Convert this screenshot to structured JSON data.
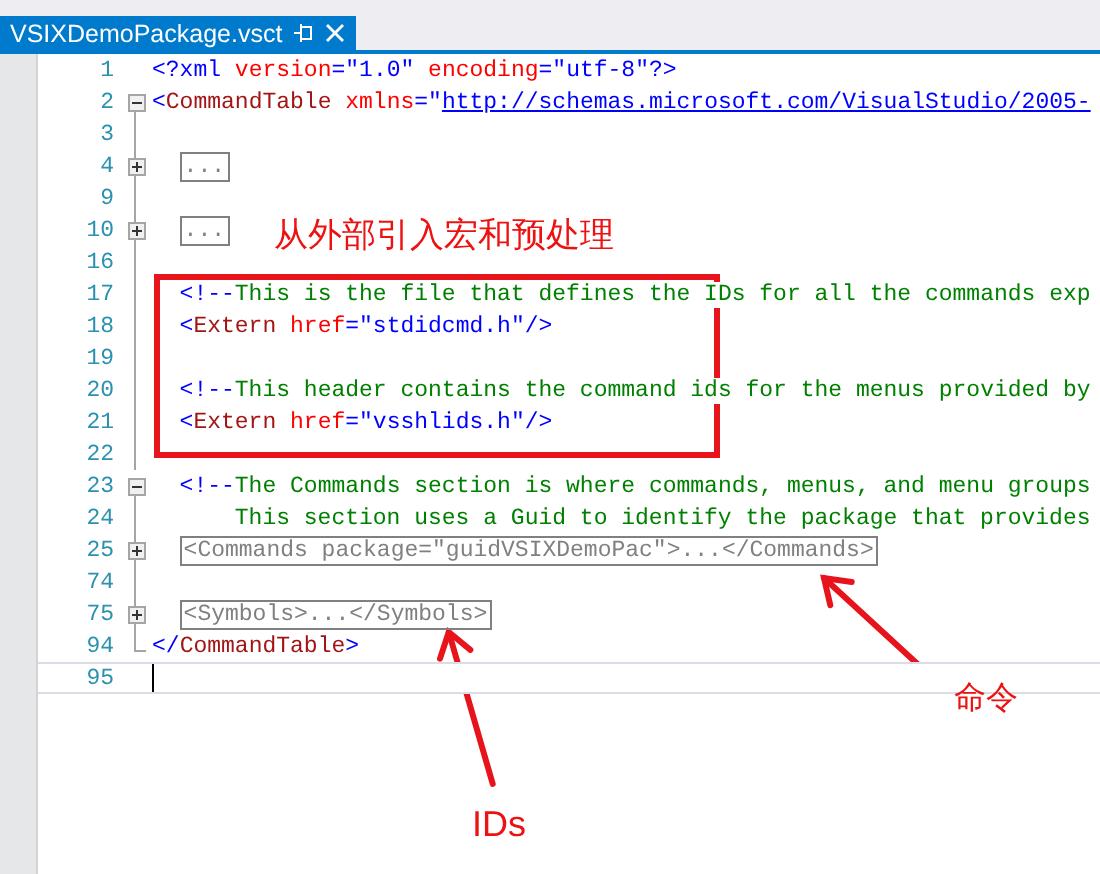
{
  "tab": {
    "title": "VSIXDemoPackage.vsct",
    "selected": true
  },
  "lines": [
    {
      "number": "1",
      "current": false,
      "tokens": [
        {
          "kind": "delim",
          "text": "<?xml "
        },
        {
          "kind": "attr",
          "text": "version"
        },
        {
          "kind": "delim",
          "text": "=\"1.0\" "
        },
        {
          "kind": "attr",
          "text": "encoding"
        },
        {
          "kind": "delim",
          "text": "=\"utf-8\"?>"
        }
      ]
    },
    {
      "number": "2",
      "current": false,
      "expanded": true,
      "tokens": [
        {
          "kind": "delim",
          "text": "<"
        },
        {
          "kind": "tag",
          "text": "CommandTable "
        },
        {
          "kind": "attr",
          "text": "xmlns"
        },
        {
          "kind": "delim",
          "text": "=\""
        },
        {
          "kind": "link",
          "text": "http://schemas.microsoft.com/VisualStudio/2005-"
        }
      ],
      "children": [
        {
          "number": "3",
          "current": false
        },
        {
          "number": "4",
          "current": false,
          "expanded": false,
          "tokens": [
            {
              "kind": "collapsed",
              "text": "..."
            }
          ]
        },
        {
          "number": "9",
          "current": false
        },
        {
          "number": "10",
          "current": false,
          "expanded": false,
          "tokens": [
            {
              "kind": "collapsed",
              "text": "..."
            }
          ]
        },
        {
          "number": "16",
          "current": false
        },
        {
          "number": "17",
          "current": false,
          "tokens": [
            {
              "kind": "delim",
              "text": "<!--"
            },
            {
              "kind": "comment",
              "text": "This is the file that defines the IDs for all the commands exp"
            }
          ]
        },
        {
          "number": "18",
          "current": false,
          "tokens": [
            {
              "kind": "delim",
              "text": "<"
            },
            {
              "kind": "tag",
              "text": "Extern "
            },
            {
              "kind": "attr",
              "text": "href"
            },
            {
              "kind": "delim",
              "text": "=\"stdidcmd.h\"/>"
            }
          ]
        },
        {
          "number": "19",
          "current": false
        },
        {
          "number": "20",
          "current": false,
          "tokens": [
            {
              "kind": "delim",
              "text": "<!--"
            },
            {
              "kind": "comment",
              "text": "This header contains the command ids for the menus provided by"
            }
          ]
        },
        {
          "number": "21",
          "current": false,
          "tokens": [
            {
              "kind": "delim",
              "text": "<"
            },
            {
              "kind": "tag",
              "text": "Extern "
            },
            {
              "kind": "attr",
              "text": "href"
            },
            {
              "kind": "delim",
              "text": "=\"vsshlids.h\"/>"
            }
          ]
        },
        {
          "number": "22",
          "current": false
        },
        {
          "number": "23",
          "current": false,
          "expanded": true,
          "tokens": [
            {
              "kind": "delim",
              "text": "<!--"
            },
            {
              "kind": "comment",
              "text": "The Commands section is where commands, menus, and menu groups"
            }
          ],
          "children": [
            {
              "number": "24",
              "current": false,
              "tokens": [
                {
                  "kind": "comment",
                  "text": "This section uses a Guid to identify the package that provides"
                }
              ]
            }
          ]
        },
        {
          "number": "25",
          "current": false,
          "expanded": false,
          "tokens": [
            {
              "kind": "collapsed",
              "text": "<Commands package=\"guidVSIXDemoPac\">...</Commands>"
            }
          ]
        },
        {
          "number": "74",
          "current": false
        },
        {
          "number": "75",
          "current": false,
          "expanded": false,
          "tokens": [
            {
              "kind": "collapsed",
              "text": "<Symbols>...</Symbols>"
            }
          ]
        }
      ]
    },
    {
      "number": "94",
      "current": false,
      "tokens": [
        {
          "kind": "delim",
          "text": "</"
        },
        {
          "kind": "tag",
          "text": "CommandTable"
        },
        {
          "kind": "delim",
          "text": ">"
        }
      ]
    },
    {
      "number": "95",
      "current": true
    }
  ],
  "notes": {
    "heading": "从外部引入宏和预处理",
    "commands": "命令",
    "ids": "IDs"
  }
}
